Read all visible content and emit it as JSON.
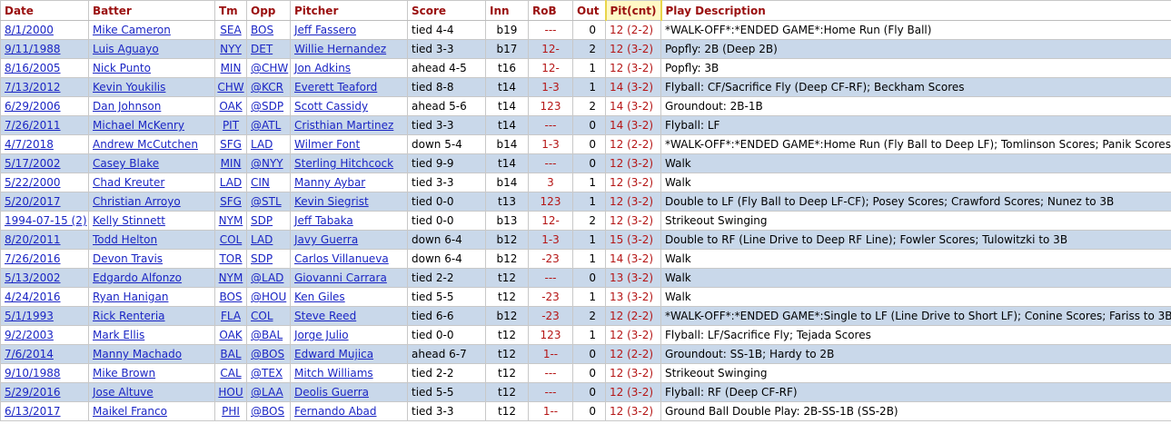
{
  "headers": {
    "date": "Date",
    "batter": "Batter",
    "tm": "Tm",
    "opp": "Opp",
    "pitcher": "Pitcher",
    "score": "Score",
    "inn": "Inn",
    "rob": "RoB",
    "out": "Out",
    "pit": "Pit(cnt)",
    "desc": "Play Description"
  },
  "rows": [
    {
      "date": "8/1/2000",
      "batter": "Mike Cameron",
      "tm": "SEA",
      "opp": "BOS",
      "pitcher": "Jeff Fassero",
      "score": "tied 4-4",
      "inn": "b19",
      "rob": "---",
      "out": "0",
      "pit": "12 (2-2)",
      "desc": "*WALK-OFF*:*ENDED GAME*:Home Run (Fly Ball)"
    },
    {
      "date": "9/11/1988",
      "batter": "Luis Aguayo",
      "tm": "NYY",
      "opp": "DET",
      "pitcher": "Willie Hernandez",
      "score": "tied 3-3",
      "inn": "b17",
      "rob": "12-",
      "out": "2",
      "pit": "12 (3-2)",
      "desc": "Popfly: 2B (Deep 2B)"
    },
    {
      "date": "8/16/2005",
      "batter": "Nick Punto",
      "tm": "MIN",
      "opp": "@CHW",
      "pitcher": "Jon Adkins",
      "score": "ahead 4-5",
      "inn": "t16",
      "rob": "12-",
      "out": "1",
      "pit": "12 (3-2)",
      "desc": "Popfly: 3B"
    },
    {
      "date": "7/13/2012",
      "batter": "Kevin Youkilis",
      "tm": "CHW",
      "opp": "@KCR",
      "pitcher": "Everett Teaford",
      "score": "tied 8-8",
      "inn": "t14",
      "rob": "1-3",
      "out": "1",
      "pit": "14 (3-2)",
      "desc": "Flyball: CF/Sacrifice Fly (Deep CF-RF); Beckham Scores"
    },
    {
      "date": "6/29/2006",
      "batter": "Dan Johnson",
      "tm": "OAK",
      "opp": "@SDP",
      "pitcher": "Scott Cassidy",
      "score": "ahead 5-6",
      "inn": "t14",
      "rob": "123",
      "out": "2",
      "pit": "14 (3-2)",
      "desc": "Groundout: 2B-1B"
    },
    {
      "date": "7/26/2011",
      "batter": "Michael McKenry",
      "tm": "PIT",
      "opp": "@ATL",
      "pitcher": "Cristhian Martinez",
      "score": "tied 3-3",
      "inn": "t14",
      "rob": "---",
      "out": "0",
      "pit": "14 (3-2)",
      "desc": "Flyball: LF"
    },
    {
      "date": "4/7/2018",
      "batter": "Andrew McCutchen",
      "tm": "SFG",
      "opp": "LAD",
      "pitcher": "Wilmer Font",
      "score": "down 5-4",
      "inn": "b14",
      "rob": "1-3",
      "out": "0",
      "pit": "12 (2-2)",
      "desc": "*WALK-OFF*:*ENDED GAME*:Home Run (Fly Ball to Deep LF); Tomlinson Scores; Panik Scores"
    },
    {
      "date": "5/17/2002",
      "batter": "Casey Blake",
      "tm": "MIN",
      "opp": "@NYY",
      "pitcher": "Sterling Hitchcock",
      "score": "tied 9-9",
      "inn": "t14",
      "rob": "---",
      "out": "0",
      "pit": "12 (3-2)",
      "desc": "Walk"
    },
    {
      "date": "5/22/2000",
      "batter": "Chad Kreuter",
      "tm": "LAD",
      "opp": "CIN",
      "pitcher": "Manny Aybar",
      "score": "tied 3-3",
      "inn": "b14",
      "rob": "3",
      "out": "1",
      "pit": "12 (3-2)",
      "desc": "Walk"
    },
    {
      "date": "5/20/2017",
      "batter": "Christian Arroyo",
      "tm": "SFG",
      "opp": "@STL",
      "pitcher": "Kevin Siegrist",
      "score": "tied 0-0",
      "inn": "t13",
      "rob": "123",
      "out": "1",
      "pit": "12 (3-2)",
      "desc": "Double to LF (Fly Ball to Deep LF-CF); Posey Scores; Crawford Scores; Nunez to 3B"
    },
    {
      "date": "1994-07-15 (2)",
      "batter": "Kelly Stinnett",
      "tm": "NYM",
      "opp": "SDP",
      "pitcher": "Jeff Tabaka",
      "score": "tied 0-0",
      "inn": "b13",
      "rob": "12-",
      "out": "2",
      "pit": "12 (3-2)",
      "desc": "Strikeout Swinging"
    },
    {
      "date": "8/20/2011",
      "batter": "Todd Helton",
      "tm": "COL",
      "opp": "LAD",
      "pitcher": "Javy Guerra",
      "score": "down 6-4",
      "inn": "b12",
      "rob": "1-3",
      "out": "1",
      "pit": "15 (3-2)",
      "desc": "Double to RF (Line Drive to Deep RF Line); Fowler Scores; Tulowitzki to 3B"
    },
    {
      "date": "7/26/2016",
      "batter": "Devon Travis",
      "tm": "TOR",
      "opp": "SDP",
      "pitcher": "Carlos Villanueva",
      "score": "down 6-4",
      "inn": "b12",
      "rob": "-23",
      "out": "1",
      "pit": "14 (3-2)",
      "desc": "Walk"
    },
    {
      "date": "5/13/2002",
      "batter": "Edgardo Alfonzo",
      "tm": "NYM",
      "opp": "@LAD",
      "pitcher": "Giovanni Carrara",
      "score": "tied 2-2",
      "inn": "t12",
      "rob": "---",
      "out": "0",
      "pit": "13 (3-2)",
      "desc": "Walk"
    },
    {
      "date": "4/24/2016",
      "batter": "Ryan Hanigan",
      "tm": "BOS",
      "opp": "@HOU",
      "pitcher": "Ken Giles",
      "score": "tied 5-5",
      "inn": "t12",
      "rob": "-23",
      "out": "1",
      "pit": "13 (3-2)",
      "desc": "Walk"
    },
    {
      "date": "5/1/1993",
      "batter": "Rick Renteria",
      "tm": "FLA",
      "opp": "COL",
      "pitcher": "Steve Reed",
      "score": "tied 6-6",
      "inn": "b12",
      "rob": "-23",
      "out": "2",
      "pit": "12 (2-2)",
      "desc": "*WALK-OFF*:*ENDED GAME*:Single to LF (Line Drive to Short LF); Conine Scores; Fariss to 3B"
    },
    {
      "date": "9/2/2003",
      "batter": "Mark Ellis",
      "tm": "OAK",
      "opp": "@BAL",
      "pitcher": "Jorge Julio",
      "score": "tied 0-0",
      "inn": "t12",
      "rob": "123",
      "out": "1",
      "pit": "12 (3-2)",
      "desc": "Flyball: LF/Sacrifice Fly; Tejada Scores"
    },
    {
      "date": "7/6/2014",
      "batter": "Manny Machado",
      "tm": "BAL",
      "opp": "@BOS",
      "pitcher": "Edward Mujica",
      "score": "ahead 6-7",
      "inn": "t12",
      "rob": "1--",
      "out": "0",
      "pit": "12 (2-2)",
      "desc": "Groundout: SS-1B; Hardy to 2B"
    },
    {
      "date": "9/10/1988",
      "batter": "Mike Brown",
      "tm": "CAL",
      "opp": "@TEX",
      "pitcher": "Mitch Williams",
      "score": "tied 2-2",
      "inn": "t12",
      "rob": "---",
      "out": "0",
      "pit": "12 (3-2)",
      "desc": "Strikeout Swinging"
    },
    {
      "date": "5/29/2016",
      "batter": "Jose Altuve",
      "tm": "HOU",
      "opp": "@LAA",
      "pitcher": "Deolis Guerra",
      "score": "tied 5-5",
      "inn": "t12",
      "rob": "---",
      "out": "0",
      "pit": "12 (3-2)",
      "desc": "Flyball: RF (Deep CF-RF)"
    },
    {
      "date": "6/13/2017",
      "batter": "Maikel Franco",
      "tm": "PHI",
      "opp": "@BOS",
      "pitcher": "Fernando Abad",
      "score": "tied 3-3",
      "inn": "t12",
      "rob": "1--",
      "out": "0",
      "pit": "12 (3-2)",
      "desc": "Ground Ball Double Play: 2B-SS-1B (SS-2B)"
    }
  ]
}
